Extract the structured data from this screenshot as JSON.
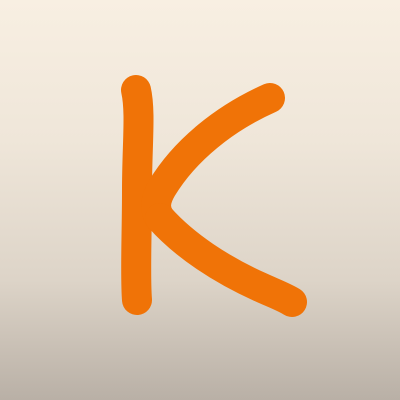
{
  "app_icon": {
    "logo": {
      "letter": "K",
      "icon_name": "k-logo-icon",
      "color": "#f07307"
    },
    "background": {
      "top_color": "#f8efe2",
      "bottom_color": "#b9b0a6"
    }
  }
}
